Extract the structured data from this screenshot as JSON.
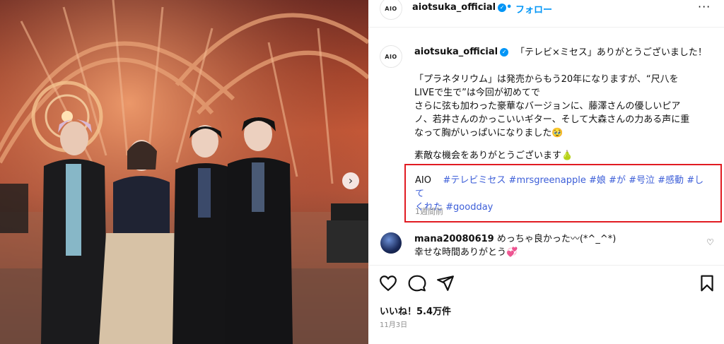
{
  "post": {
    "username": "aiotsuka_official",
    "avatar_text": "AIO",
    "follow_label": "フォロー",
    "separator": "•",
    "more_label": "···"
  },
  "caption": {
    "username": "aiotsuka_official",
    "lines": [
      "「テレビ×ミセス」ありがとうございました！",
      "",
      "「プラネタリウム」は発売からもう20年になりますが、“尺八を",
      "LIVEで生で”は今回が初めてで",
      "さらに弦も加わった豪華なバージョンに、藤澤さんの優しいピア",
      "ノ、若井さんのかっこいいギター、そして大森さんの力ある声に重",
      "なって胸がいっぱいになりました🥹",
      "",
      "素敵な機会をありがとうございます🍐"
    ],
    "hashtag_prefix": "AIO",
    "hashtags_line1": [
      "#テレビミセス",
      "#mrsgreenapple",
      "#娘",
      "#が",
      "#号泣",
      "#感動",
      "#して"
    ],
    "hashtags_line2": [
      "くれた",
      "#goodday"
    ],
    "time_ago": "1週間前"
  },
  "comment": {
    "username": "mana20080619",
    "text_line1": "めっちゃ良かった〰(*^_^*)",
    "text_line2": "幸せな時間ありがとう💞"
  },
  "actions": {
    "icons": [
      "heart-icon",
      "comment-icon",
      "share-icon",
      "bookmark-icon"
    ],
    "likes_label": "いいね！5.4万件",
    "date": "11月3日"
  },
  "colors": {
    "accent": "#0095f6",
    "hashtag": "#3c5ed8",
    "highlight_box": "#e11b22"
  }
}
